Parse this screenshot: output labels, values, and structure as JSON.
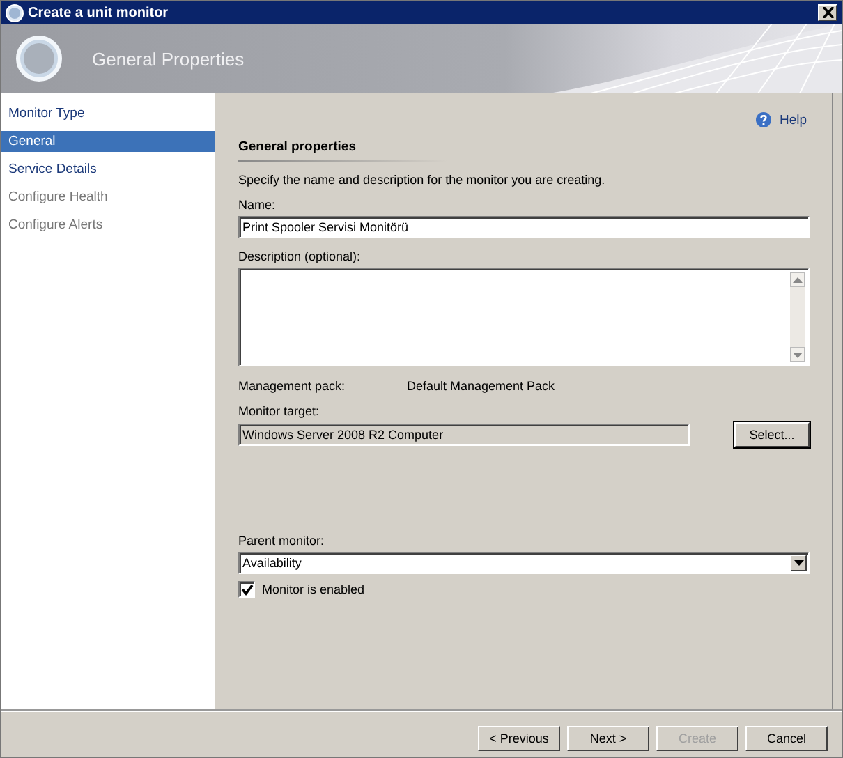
{
  "window": {
    "title": "Create a unit monitor"
  },
  "header": {
    "title": "General Properties"
  },
  "steps": [
    {
      "label": "Monitor Type",
      "selected": false,
      "disabled": false
    },
    {
      "label": "General",
      "selected": true,
      "disabled": false
    },
    {
      "label": "Service Details",
      "selected": false,
      "disabled": false
    },
    {
      "label": "Configure Health",
      "selected": false,
      "disabled": true
    },
    {
      "label": "Configure Alerts",
      "selected": false,
      "disabled": true
    }
  ],
  "help": {
    "label": "Help"
  },
  "section": {
    "title": "General properties",
    "instructions": "Specify the name and description for the monitor you are creating."
  },
  "name": {
    "label": "Name:",
    "value": "Print Spooler Servisi Monitörü"
  },
  "description": {
    "label": "Description (optional):"
  },
  "management_pack": {
    "label": "Management pack:",
    "value": "Default Management Pack"
  },
  "monitor_target": {
    "label": "Monitor target:",
    "value": "Windows Server 2008 R2 Computer",
    "disabled": true,
    "button": "Select..."
  },
  "parent_monitor": {
    "label": "Parent monitor:",
    "value": "Availability"
  },
  "monitor_enabled": {
    "label": "Monitor is enabled",
    "checked": true
  },
  "buttons": [
    {
      "label": "< Previous",
      "disabled": false
    },
    {
      "label": "Next >",
      "disabled": false
    },
    {
      "label": "Create",
      "disabled": true
    },
    {
      "label": "Cancel",
      "disabled": false
    }
  ]
}
